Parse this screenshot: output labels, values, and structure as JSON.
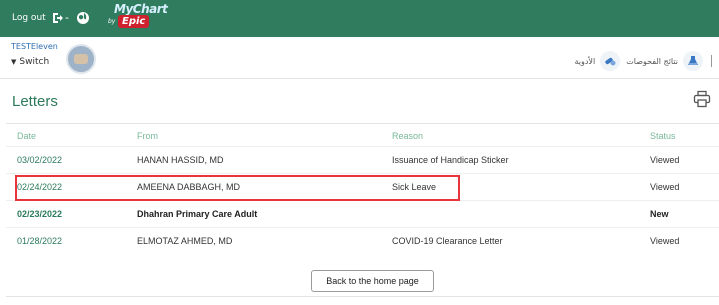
{
  "topbar": {
    "logout_label": "Log out",
    "dash": "-",
    "logo": {
      "my_chart": "MyChart",
      "by": "by",
      "epic": "Epic"
    },
    "colors": {
      "background": "#2f7d5e",
      "epic_red": "#d0212f"
    }
  },
  "user": {
    "name": "TESTEleven",
    "switch_label": "Switch"
  },
  "rtl_nav": {
    "items": [
      {
        "label": "نتائج الفحوصات",
        "icon": "flask-icon"
      },
      {
        "label": "الأدوية",
        "icon": "pills-icon"
      }
    ]
  },
  "page": {
    "title": "Letters",
    "print_icon": "printer-icon"
  },
  "letters_table": {
    "headers": {
      "date": "Date",
      "from": "From",
      "reason": "Reason",
      "status": "Status"
    },
    "rows": [
      {
        "date": "03/02/2022",
        "from": "HANAN HASSID, MD",
        "reason": "Issuance of Handicap Sticker",
        "status": "Viewed",
        "new": false
      },
      {
        "date": "02/24/2022",
        "from": "AMEENA DABBAGH, MD",
        "reason": "Sick Leave",
        "status": "Viewed",
        "new": false,
        "highlighted": true
      },
      {
        "date": "02/23/2022",
        "from": "Dhahran Primary Care Adult",
        "reason": "",
        "status": "New",
        "new": true
      },
      {
        "date": "01/28/2022",
        "from": "ELMOTAZ AHMED, MD",
        "reason": "COVID-19 Clearance Letter",
        "status": "Viewed",
        "new": false
      }
    ]
  },
  "footer": {
    "back_label": "Back to the home page"
  },
  "colors": {
    "accent_green": "#2b7a5b",
    "header_green": "#7ab89a",
    "highlight_red": "#e8343a"
  }
}
